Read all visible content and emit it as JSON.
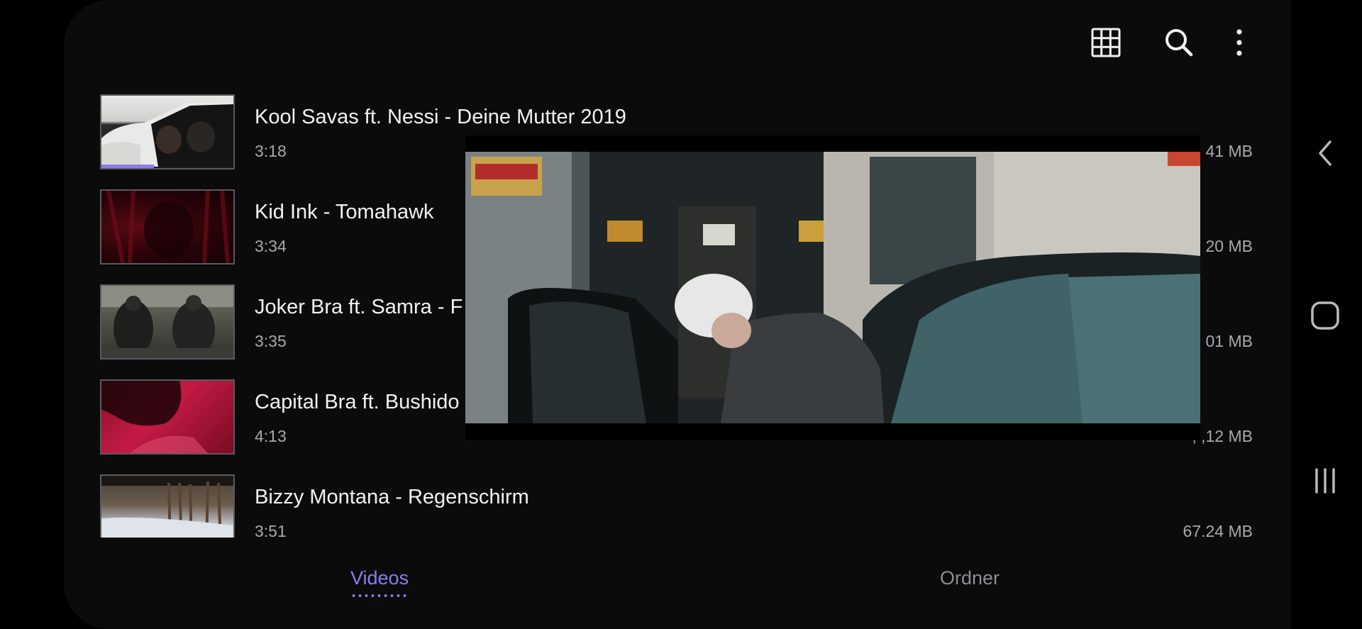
{
  "toolbar": {
    "icons": [
      "grid-icon",
      "search-icon",
      "more-vertical-icon"
    ]
  },
  "videos": [
    {
      "title": "Kool Savas ft. Nessi - Deine Mutter 2019",
      "duration": "3:18",
      "size": "41 MB",
      "progress": 0.4
    },
    {
      "title": "Kid Ink - Tomahawk",
      "duration": "3:34",
      "size": "20 MB"
    },
    {
      "title": "Joker Bra ft. Samra - F",
      "duration": "3:35",
      "size": "01 MB"
    },
    {
      "title": "Capital Bra ft. Bushido",
      "duration": "4:13",
      "size": ", ,12 MB"
    },
    {
      "title": "Bizzy Montana - Regenschirm",
      "duration": "3:51",
      "size": "67.24 MB"
    }
  ],
  "tabs": {
    "videos_label": "Videos",
    "folders_label": "Ordner"
  },
  "system_nav": {
    "icons": [
      "back-icon",
      "home-icon",
      "recents-icon"
    ]
  },
  "colors": {
    "accent": "#8b7cf0",
    "background": "#0b0b0c"
  }
}
